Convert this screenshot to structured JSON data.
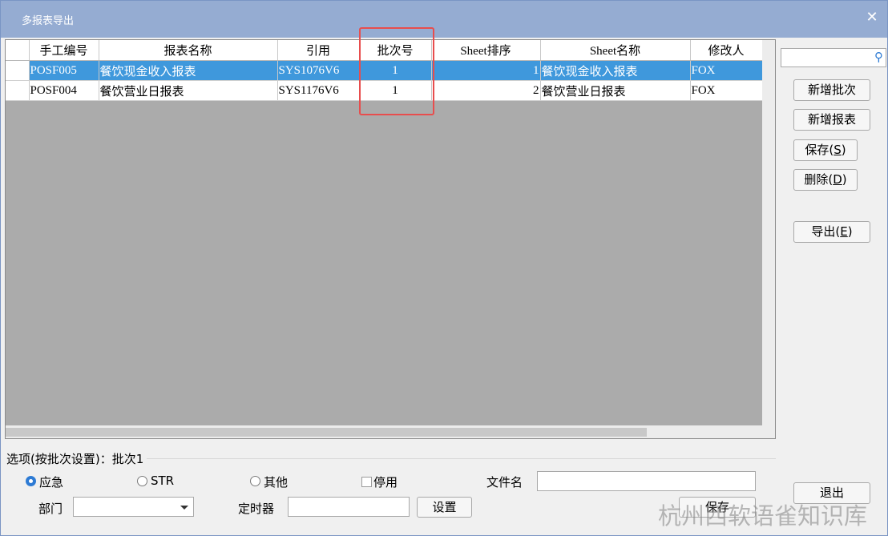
{
  "window": {
    "title": "多报表导出",
    "close_symbol": "✕"
  },
  "grid": {
    "columns": [
      "手工编号",
      "报表名称",
      "引用",
      "批次号",
      "Sheet排序",
      "Sheet名称",
      "修改人"
    ],
    "rows": [
      {
        "code": "POSF005",
        "name": "餐饮现金收入报表",
        "ref": "SYS1076V6",
        "batch": "1",
        "sheet_order": "1",
        "sheet_name": "餐饮现金收入报表",
        "modifier": "FOX",
        "selected": true
      },
      {
        "code": "POSF004",
        "name": "餐饮营业日报表",
        "ref": "SYS1176V6",
        "batch": "1",
        "sheet_order": "2",
        "sheet_name": "餐饮营业日报表",
        "modifier": "FOX",
        "selected": false
      }
    ]
  },
  "side_buttons": {
    "add_batch": "新增批次",
    "add_report": "新增报表",
    "save_prefix": "保存(",
    "save_key": "S",
    "suffix": ")",
    "delete_prefix": "删除(",
    "delete_key": "D",
    "export_prefix": "导出(",
    "export_key": "E",
    "exit": "退出"
  },
  "options": {
    "group_label": "选项(按批次设置)：批次1",
    "radio_urgent": "应急",
    "radio_str": "STR",
    "radio_other": "其他",
    "check_disable": "停用",
    "filename_label": "文件名",
    "dept_label": "部门",
    "timer_label": "定时器",
    "settings_button": "设置",
    "save_button": "保存"
  },
  "watermark": "杭州西软语雀知识库",
  "colors": {
    "title_bar": "#95acd2",
    "selection": "#3f98dc",
    "highlight_box": "#e84d4d"
  }
}
